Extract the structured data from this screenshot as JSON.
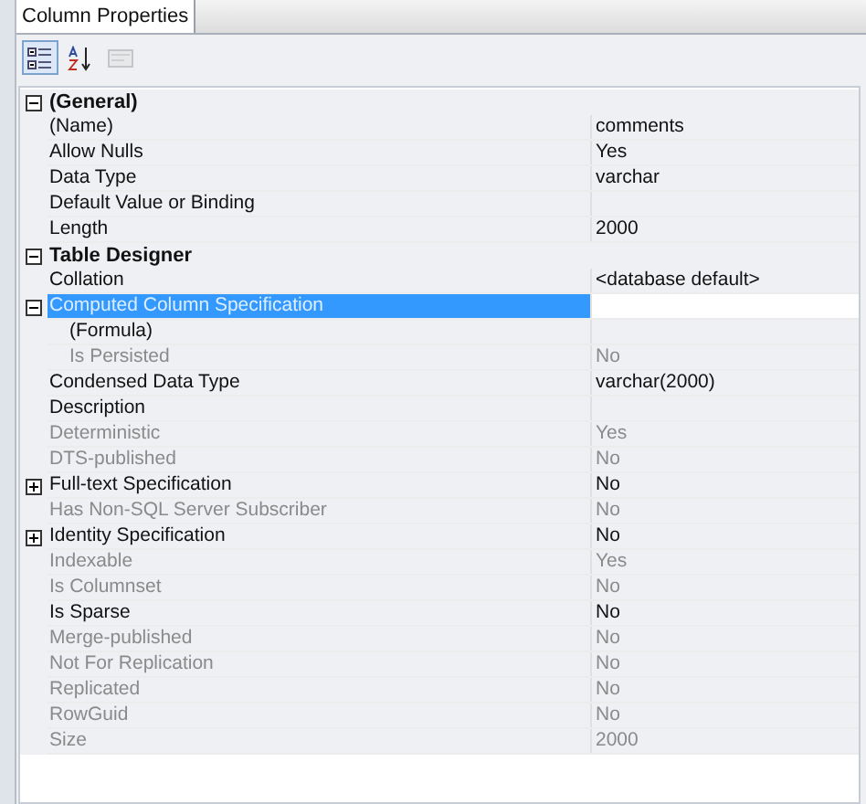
{
  "tab": {
    "label": "Column Properties",
    "selected": true
  },
  "toolbar": [
    {
      "kind": "categorized",
      "selected": true,
      "disabled": false
    },
    {
      "kind": "alphabetical",
      "selected": false,
      "disabled": false
    },
    {
      "kind": "pages",
      "selected": false,
      "disabled": true
    }
  ],
  "categories": [
    {
      "name": "(General)",
      "expanded": true,
      "children": [
        {
          "name": "(Name)",
          "value": "comments",
          "readonly": false,
          "selected": false
        },
        {
          "name": "Allow Nulls",
          "value": "Yes",
          "readonly": false,
          "selected": false
        },
        {
          "name": "Data Type",
          "value": "varchar",
          "readonly": false,
          "selected": false
        },
        {
          "name": "Default Value or Binding",
          "readonly": false,
          "selected": false
        },
        {
          "name": "Length",
          "value": "2000",
          "readonly": false,
          "selected": false
        }
      ]
    },
    {
      "name": "Table Designer",
      "expanded": true,
      "children": [
        {
          "name": "Collation",
          "value": "<database default>",
          "readonly": false,
          "selected": false
        },
        {
          "name": "Computed Column Specification",
          "readonly": false,
          "selected": true,
          "expanded": true,
          "children": [
            {
              "name": "(Formula)",
              "readonly": false,
              "selected": false
            },
            {
              "name": "Is Persisted",
              "value": "No",
              "readonly": true,
              "selected": false
            }
          ]
        },
        {
          "name": "Condensed Data Type",
          "value": "varchar(2000)",
          "readonly": false,
          "selected": false
        },
        {
          "name": "Description",
          "readonly": false,
          "selected": false
        },
        {
          "name": "Deterministic",
          "value": "Yes",
          "readonly": true,
          "selected": false
        },
        {
          "name": "DTS-published",
          "value": "No",
          "readonly": true,
          "selected": false
        },
        {
          "name": "Full-text Specification",
          "value": "No",
          "readonly": false,
          "selected": false,
          "expanded": false
        },
        {
          "name": "Has Non-SQL Server Subscriber",
          "value": "No",
          "readonly": true,
          "selected": false
        },
        {
          "name": "Identity Specification",
          "value": "No",
          "readonly": false,
          "selected": false,
          "expanded": false
        },
        {
          "name": "Indexable",
          "value": "Yes",
          "readonly": true,
          "selected": false
        },
        {
          "name": "Is Columnset",
          "value": "No",
          "readonly": true,
          "selected": false
        },
        {
          "name": "Is Sparse",
          "value": "No",
          "readonly": false,
          "selected": false
        },
        {
          "name": "Merge-published",
          "value": "No",
          "readonly": true,
          "selected": false
        },
        {
          "name": "Not For Replication",
          "value": "No",
          "readonly": true,
          "selected": false
        },
        {
          "name": "Replicated",
          "value": "No",
          "readonly": true,
          "selected": false
        },
        {
          "name": "RowGuid",
          "value": "No",
          "readonly": true,
          "selected": false
        },
        {
          "name": "Size",
          "value": "2000",
          "readonly": true,
          "selected": false
        }
      ]
    }
  ]
}
